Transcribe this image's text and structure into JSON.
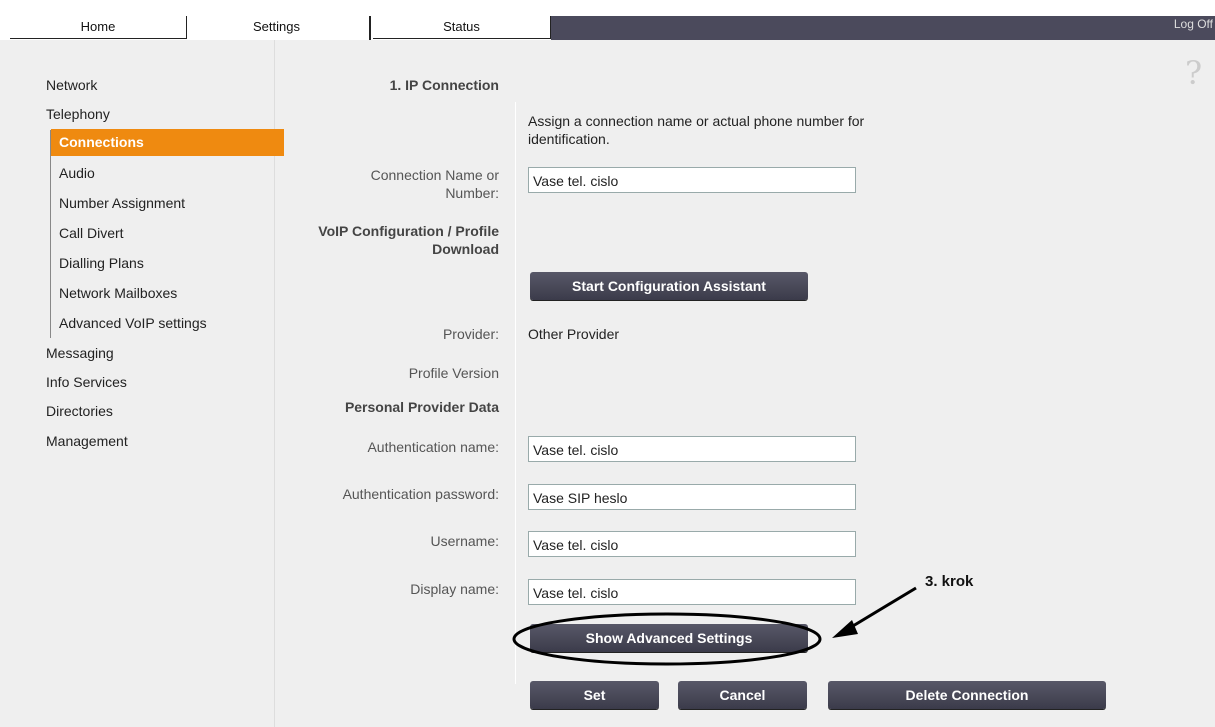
{
  "tabs": {
    "home": "Home",
    "settings": "Settings",
    "status": "Status"
  },
  "logoff": "Log Off",
  "help": "?",
  "sidebar": {
    "network": "Network",
    "telephony": "Telephony",
    "connections": "Connections",
    "audio": "Audio",
    "number_assignment": "Number Assignment",
    "call_divert": "Call Divert",
    "dialling_plans": "Dialling Plans",
    "network_mailboxes": "Network Mailboxes",
    "advanced_voip": "Advanced VoIP settings",
    "messaging": "Messaging",
    "info_services": "Info Services",
    "directories": "Directories",
    "management": "Management"
  },
  "form": {
    "section_ip": "1. IP Connection",
    "assign_text_1": "Assign a connection name or actual phone number for",
    "assign_text_2": "identification.",
    "conn_name_label_1": "Connection Name or",
    "conn_name_label_2": "Number:",
    "conn_name_value": "Vase tel. cislo",
    "voip_label_1": "VoIP Configuration / Profile",
    "voip_label_2": "Download",
    "start_assistant": "Start Configuration Assistant",
    "provider_label": "Provider:",
    "provider_value": "Other Provider",
    "profile_version_label": "Profile Version",
    "personal_data_label": "Personal Provider Data",
    "auth_name_label": "Authentication name:",
    "auth_name_value": "Vase tel. cislo",
    "auth_pass_label": "Authentication password:",
    "auth_pass_value": "Vase SIP heslo",
    "username_label": "Username:",
    "username_value": "Vase tel. cislo",
    "display_label": "Display name:",
    "display_value": "Vase tel. cislo",
    "show_advanced": "Show Advanced Settings",
    "set": "Set",
    "cancel": "Cancel",
    "delete": "Delete Connection"
  },
  "annotation": {
    "text": "3. krok"
  }
}
